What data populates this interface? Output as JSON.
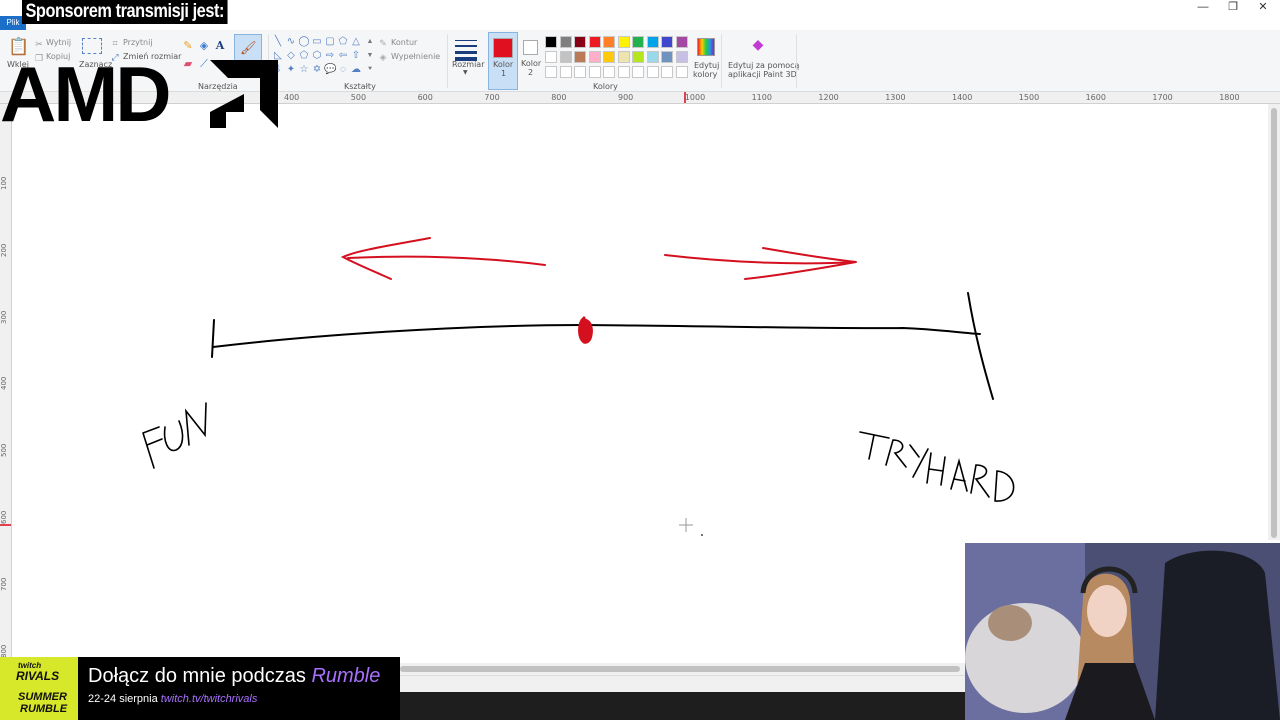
{
  "window": {
    "file_tab": "Plik",
    "minimize_icon": "—",
    "restore_icon": "❐",
    "close_icon": "✕"
  },
  "ribbon": {
    "clipboard": {
      "paste": "Wklej",
      "cut": "Wytnij",
      "copy": "Kopiuj"
    },
    "image": {
      "select": "Zaznacz",
      "crop": "Przytnij",
      "resize": "Zmień rozmiar"
    },
    "tools": {
      "label": "Narzędzia"
    },
    "shapes": {
      "label": "Kształty",
      "outline": "Kontur",
      "fill": "Wypełnienie"
    },
    "size": {
      "label": "Rozmiar"
    },
    "color1": {
      "label": "Kolor",
      "sub": "1",
      "value": "#e01020"
    },
    "color2": {
      "label": "Kolor",
      "sub": "2",
      "value": "#ffffff"
    },
    "colors": {
      "label": "Kolory",
      "row1": [
        "#000000",
        "#7f7f7f",
        "#880015",
        "#ed1c24",
        "#ff7f27",
        "#fff200",
        "#22b14c",
        "#00a2e8",
        "#3f48cc",
        "#a349a4"
      ],
      "row2": [
        "#ffffff",
        "#c3c3c3",
        "#b97a57",
        "#ffaec9",
        "#ffc90e",
        "#efe4b0",
        "#b5e61d",
        "#99d9ea",
        "#7092be",
        "#c8bfe7"
      ],
      "row3": [
        "#ffffff",
        "#ffffff",
        "#ffffff",
        "#ffffff",
        "#ffffff",
        "#ffffff",
        "#ffffff",
        "#ffffff",
        "#ffffff",
        "#ffffff"
      ]
    },
    "edit_colors": {
      "line1": "Edytuj",
      "line2": "kolory"
    },
    "paint3d": {
      "line1": "Edytuj za pomocą",
      "line2": "aplikacji Paint 3D"
    }
  },
  "ruler": {
    "h_ticks": [
      "400",
      "500",
      "600",
      "700",
      "800",
      "900",
      "1000",
      "1100",
      "1200",
      "1300",
      "1400",
      "1500",
      "1600",
      "1700",
      "1800"
    ],
    "v_ticks": [
      "100",
      "200",
      "300",
      "400",
      "500",
      "600",
      "700",
      "800"
    ]
  },
  "drawing": {
    "left_label": "FUN",
    "right_label": "TRYHARD",
    "ink": "#000000",
    "accent": "#d4101f"
  },
  "overlay": {
    "sponsor": "Sponsorem transmisji jest:",
    "brand": "AMD",
    "banner": {
      "logo_line1": "twitch",
      "logo_line2": "RIVALS",
      "logo_line3": "SUMMER",
      "logo_line4": "RUMBLE",
      "main_prefix": "Dołącz do mnie podczas ",
      "main_emphasis": "Rumble",
      "date": "22-24 sierpnia",
      "url": "twitch.tv/twitchrivals"
    }
  }
}
